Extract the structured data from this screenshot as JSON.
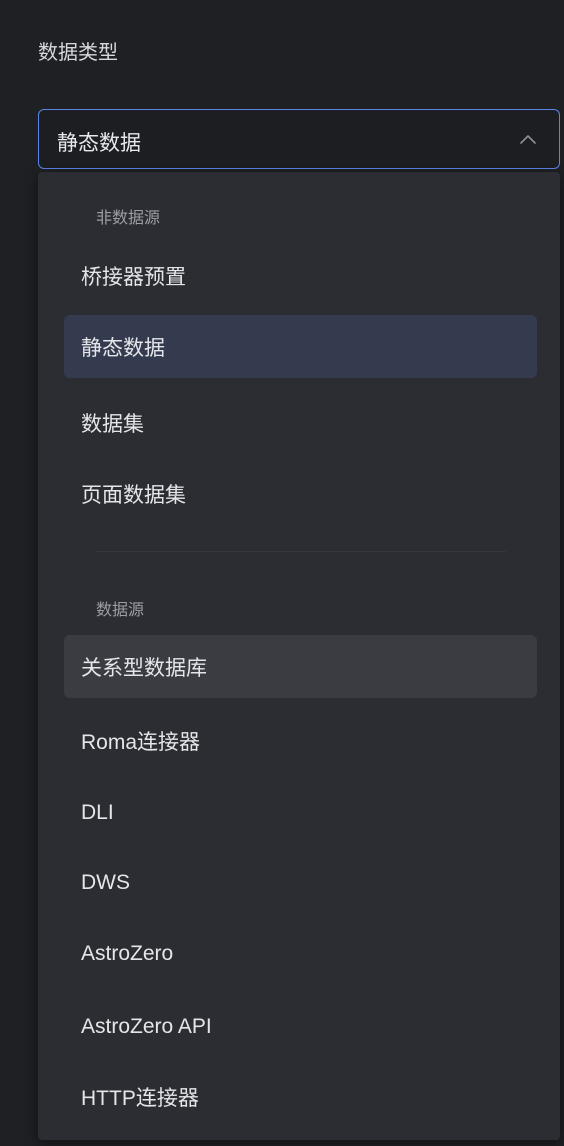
{
  "field": {
    "label": "数据类型",
    "selected_value": "静态数据",
    "chevron_icon": "chevron-up-icon"
  },
  "dropdown": {
    "groups": [
      {
        "title": "非数据源",
        "options": [
          "桥接器预置",
          "静态数据",
          "数据集",
          "页面数据集"
        ]
      },
      {
        "title": "数据源",
        "options": [
          "关系型数据库",
          "Roma连接器",
          "DLI",
          "DWS",
          "AstroZero",
          "AstroZero API",
          "HTTP连接器"
        ]
      }
    ],
    "selected_option": "静态数据",
    "hovered_option": "关系型数据库"
  },
  "colors": {
    "accent": "#5b84e8",
    "panel_bg": "#1f2024",
    "dropdown_bg": "#2c2d32",
    "selected_bg": "#353b4e",
    "hover_bg": "#3b3c42"
  }
}
